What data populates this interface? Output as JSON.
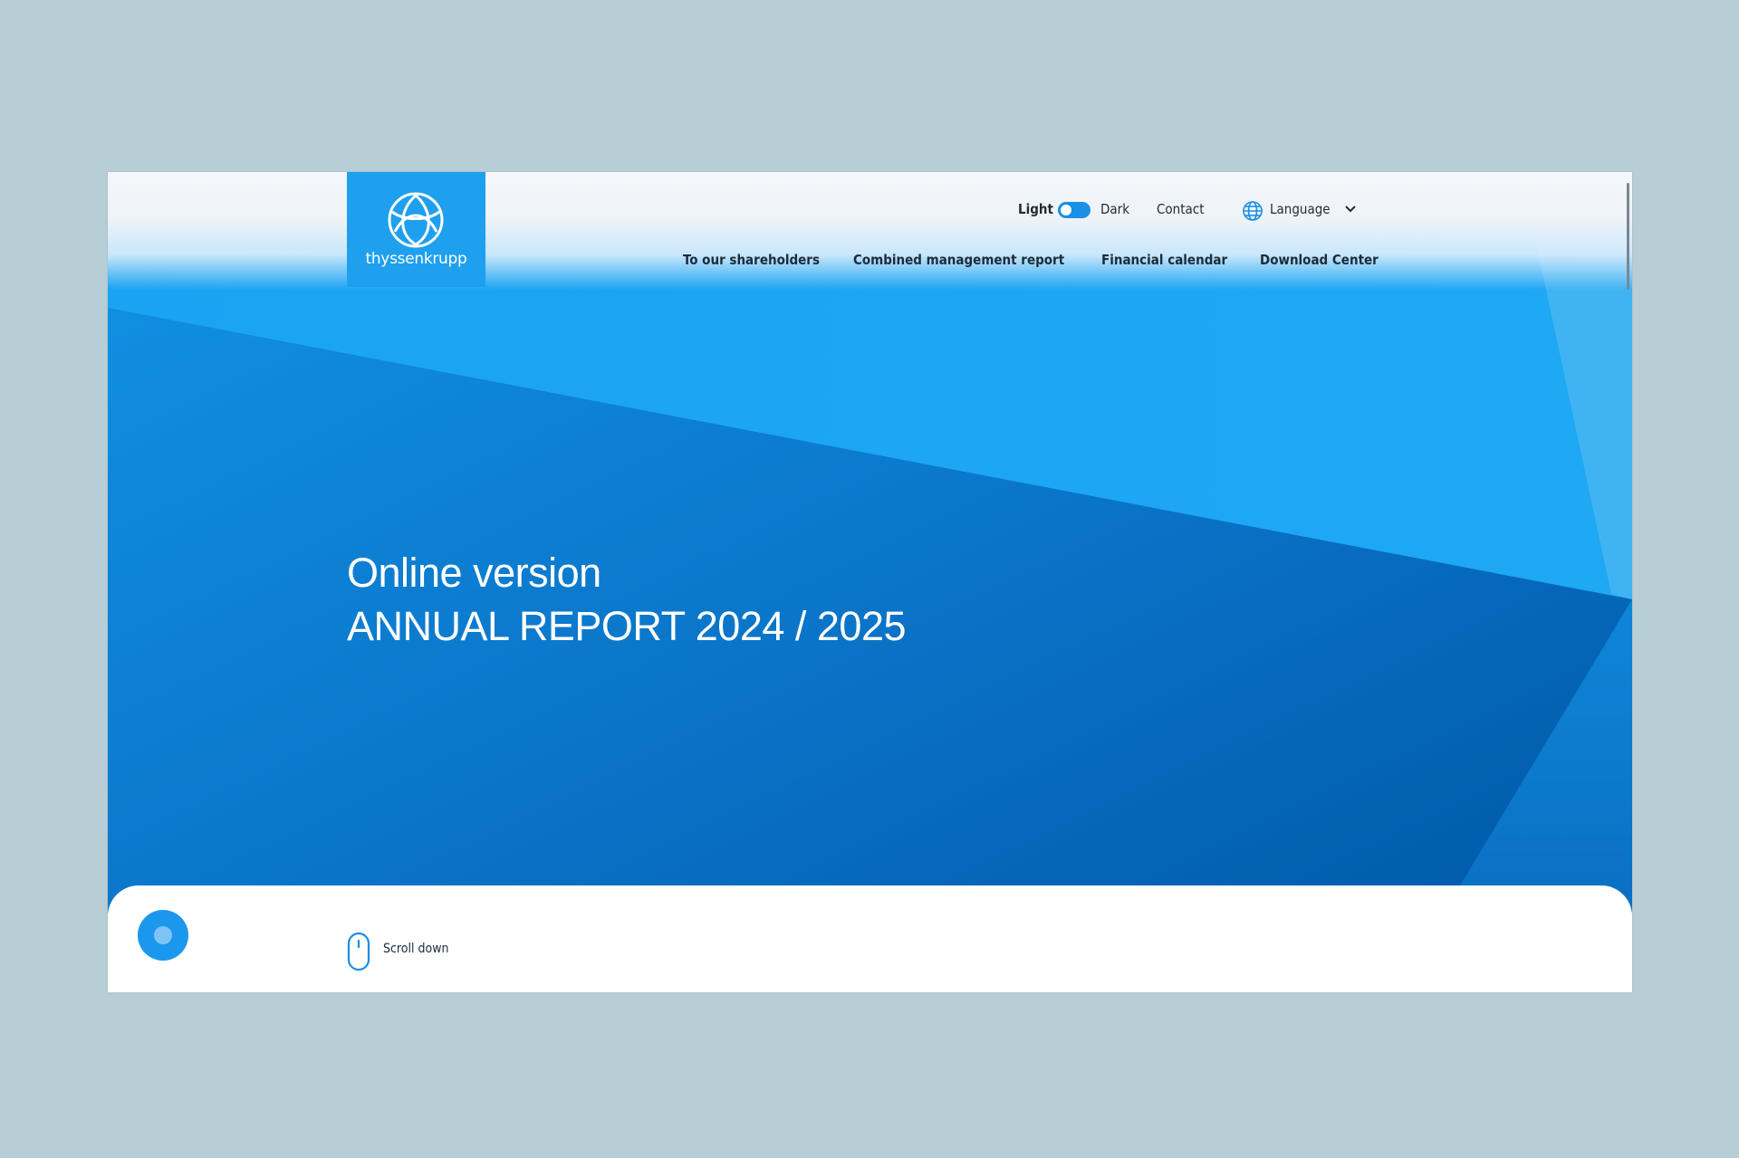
{
  "brand": {
    "logo_text": "thyssenkrupp",
    "color": "#1ea0ef"
  },
  "utility_nav": {
    "light_label": "Light",
    "dark_label": "Dark",
    "theme_mode": "light",
    "contact_label": "Contact",
    "language_label": "Language"
  },
  "main_nav": {
    "items": [
      "To our shareholders",
      "Combined management report",
      "Financial calendar",
      "Download Center"
    ]
  },
  "hero": {
    "line1": "Online version",
    "line2": "ANNUAL REPORT 2024 / 2025"
  },
  "footer": {
    "scroll_label": "Scroll down"
  },
  "icons": {
    "logo": "thyssenkrupp-logo-icon",
    "language": "globe-icon",
    "dropdown": "chevron-down-icon",
    "scroll": "mouse-icon"
  },
  "colors": {
    "page_background": "#b8ced6",
    "hero_light": "#16a4f2",
    "hero_dark": "#0062b0",
    "toggle": "#1a8fe6"
  }
}
